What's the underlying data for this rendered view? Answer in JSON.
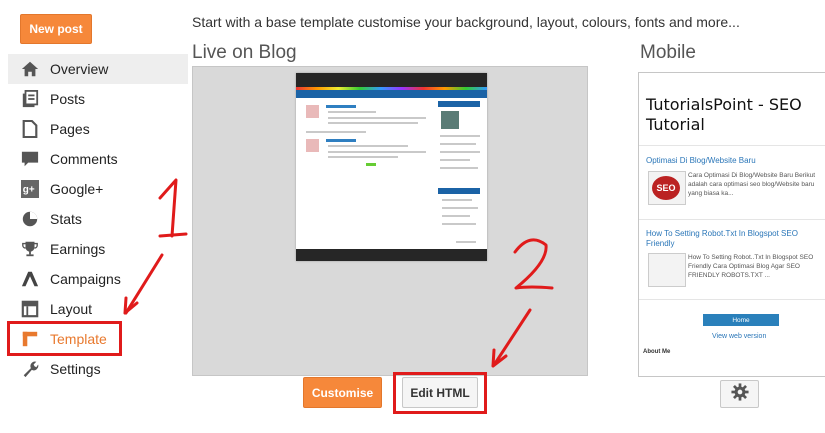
{
  "sidebar": {
    "new_post_label": "New post",
    "items": [
      {
        "label": "Overview",
        "icon": "home-icon"
      },
      {
        "label": "Posts",
        "icon": "posts-icon"
      },
      {
        "label": "Pages",
        "icon": "pages-icon"
      },
      {
        "label": "Comments",
        "icon": "comments-icon"
      },
      {
        "label": "Google+",
        "icon": "google-plus-icon"
      },
      {
        "label": "Stats",
        "icon": "stats-icon"
      },
      {
        "label": "Earnings",
        "icon": "trophy-icon"
      },
      {
        "label": "Campaigns",
        "icon": "campaigns-icon"
      },
      {
        "label": "Layout",
        "icon": "layout-icon"
      },
      {
        "label": "Template",
        "icon": "template-icon"
      },
      {
        "label": "Settings",
        "icon": "wrench-icon"
      }
    ],
    "selected": "Overview",
    "active": "Template"
  },
  "main": {
    "intro": "Start with a base template customise your background, layout, colours, fonts and more...",
    "live_heading": "Live on Blog",
    "mobile_heading": "Mobile",
    "mobile_preview": {
      "blog_title": "TutorialsPoint - SEO Tutorial",
      "post1_title": "Optimasi Di Blog/Website Baru",
      "post1_desc": "Cara Optimasi Di Blog/Website Baru Berikut adalah cara optimasi seo blog/Website baru yang biasa ka...",
      "post1_thumb": "SEO",
      "post2_title": "How To Setting Robot.Txt In Blogspot SEO Friendly",
      "post2_desc": "How To Setting Robot..Txt In Blogspot SEO Friendly Cara Optimasi Blog Agar SEO FRIENDLY ROBOTS.TXT ...",
      "home_label": "Home",
      "web_version_label": "View web version",
      "about_label": "About Me"
    },
    "customise_label": "Customise",
    "edit_html_label": "Edit HTML"
  },
  "annotations": {
    "mark1": "1",
    "mark2": "2",
    "color": "#e01b1b"
  },
  "colors": {
    "accent_orange": "#f6883a",
    "link_blue": "#2a76b8"
  }
}
